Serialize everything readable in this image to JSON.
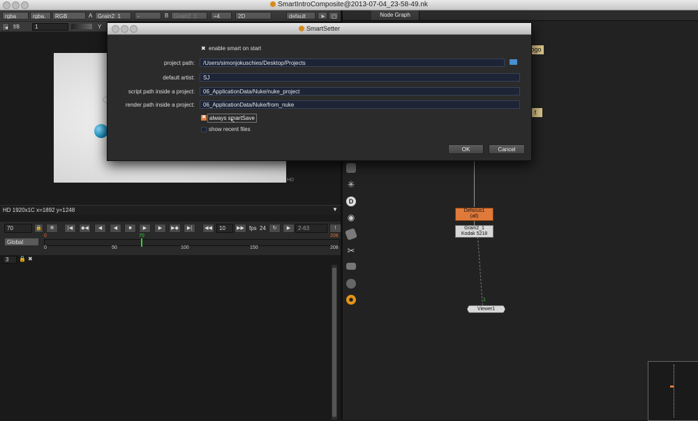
{
  "window": {
    "title": "SmartIntroComposite@2013-07-04_23-58-49.nk"
  },
  "viewer_toolbar": {
    "channels": "rgba",
    "layer": "rgba.",
    "display": "RGB",
    "a_label": "A",
    "a_input": "Grain2_1",
    "a_op": "-",
    "b_label": "B",
    "b_input": "Grain2_1",
    "zoom": "÷4",
    "view": "2D",
    "lut": "default",
    "fstop": "f/8",
    "frame": "1",
    "y_label": "Y"
  },
  "node_graph_tab": {
    "label": "Node Graph"
  },
  "dialog": {
    "title": "SmartSetter",
    "enable_label": "enable smart on start",
    "project_path_label": "project path:",
    "project_path": "/Users/simonjokuschies/Desktop/Projects",
    "artist_label": "default artist:",
    "artist": "SJ",
    "script_label": "script path inside a project:",
    "script": "06_ApplicationData/Nuke/nuke_project",
    "render_label": "render path inside a project:",
    "render": "06_ApplicationData/Nuke/from_nuke",
    "always_label": "always smartSave",
    "recent_label": "show recent files",
    "ok": "OK",
    "cancel": "Cancel"
  },
  "viewer": {
    "format_tag": "HD",
    "info": "HD 1920x1C  x=1892 y=1248"
  },
  "timeline": {
    "current_frame": "70",
    "increment": "10",
    "fps_label": "fps",
    "fps": "24",
    "range": "2-63",
    "scope": "Global",
    "start": "0",
    "end": "208",
    "marker": "70",
    "ticks": [
      "0",
      "50",
      "100",
      "150",
      "208"
    ]
  },
  "properties": {
    "count": "3"
  },
  "nodes": {
    "partial_top": "ogo",
    "partial_mid": "t",
    "defocus": "Defocus1",
    "defocus_sub": "(all)",
    "grain": "Grain2_1",
    "grain_sub": "Kodak 5218",
    "viewer": "Viewer1",
    "viewer_input": "1"
  }
}
